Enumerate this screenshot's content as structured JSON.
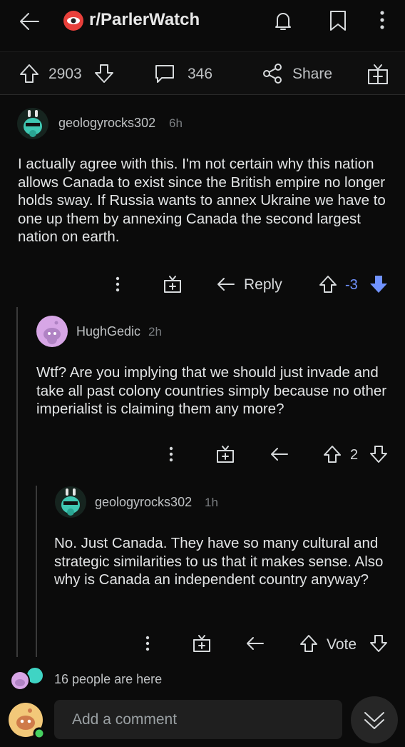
{
  "header": {
    "subreddit": "r/ParlerWatch",
    "back_icon": "arrow-left-icon",
    "sub_icon": "subreddit-icon",
    "bell_icon": "bell-icon",
    "bookmark_icon": "bookmark-icon",
    "more_icon": "more-vertical-icon"
  },
  "post_actions": {
    "score": "2903",
    "comments": "346",
    "share_label": "Share"
  },
  "comments": [
    {
      "username": "geologyrocks302",
      "age": "6h",
      "body": "I actually agree with this. I'm not certain why this nation allows Canada to exist since the British empire no longer holds sway. If Russia wants to annex Ukraine we have to one up them by annexing Canada the second largest nation on earth.",
      "reply_label": "Reply",
      "score": "-3"
    },
    {
      "username": "HughGedic",
      "age": "2h",
      "body": "Wtf? Are you implying that we should just invade and take all past colony countries simply because no other imperialist is claiming them any more?",
      "score": "2"
    },
    {
      "username": "geologyrocks302",
      "age": "1h",
      "body": "No. Just Canada. They have so many cultural and strategic similarities to us that it makes sense. Also why is Canada an independent country anyway?",
      "vote_label": "Vote"
    }
  ],
  "presence": {
    "text": "16 people are here"
  },
  "composer": {
    "placeholder": "Add a comment"
  },
  "colors": {
    "background": "#0b0b0b",
    "downvote_blue": "#7193ff",
    "brand_red": "#ff4500",
    "online_green": "#46d160"
  }
}
